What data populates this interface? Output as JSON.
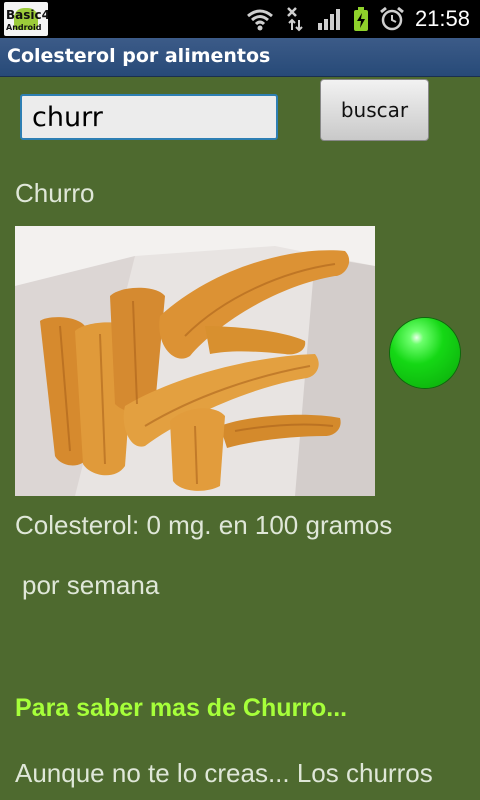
{
  "status_bar": {
    "time": "21:58",
    "icons": [
      "wifi-icon",
      "no-data-icon",
      "signal-icon",
      "battery-charging-icon",
      "alarm-icon"
    ]
  },
  "app_icon": {
    "line1": "Basic4",
    "line2": "Android"
  },
  "title_bar": {
    "title": "Colesterol por alimentos"
  },
  "search": {
    "value": "churr",
    "button_label": "buscar"
  },
  "result": {
    "name": "Churro",
    "image_name": "churro-photo",
    "indicator_color": "#19d619",
    "cholesterol_text": "Colesterol: 0 mg. en 100 gramos",
    "frequency_text": " por semana",
    "more_heading": "Para saber mas de Churro...",
    "description": "Aunque no te lo creas... Los churros"
  },
  "colors": {
    "background": "#4e6a2f",
    "accent_heading": "#a6ff3a",
    "title_bar": "#2f5080"
  }
}
